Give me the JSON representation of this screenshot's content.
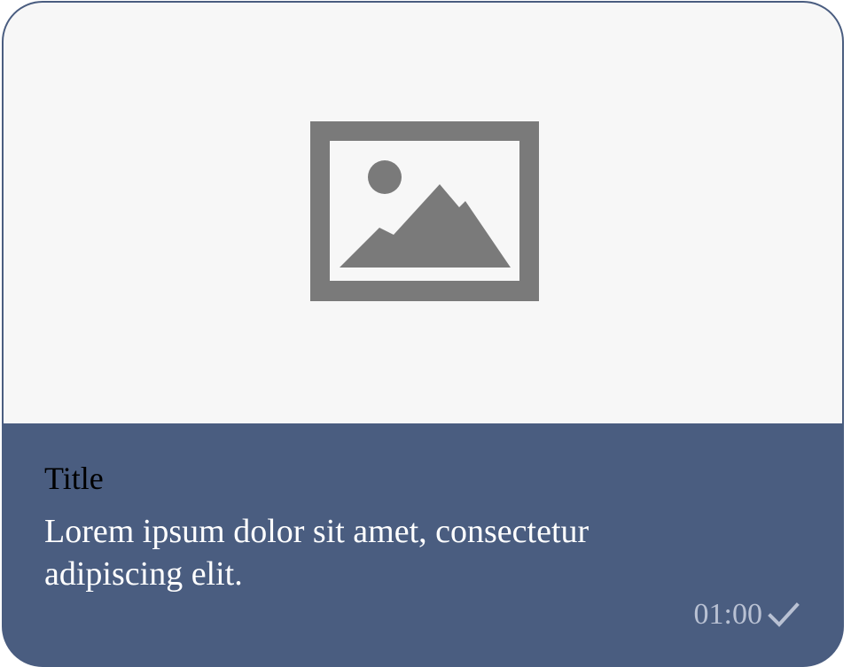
{
  "card": {
    "media": {
      "icon": "image-placeholder-icon"
    },
    "title": "Title",
    "description": "Lorem ipsum dolor sit amet, consectetur adipiscing elit.",
    "time": "01:00",
    "status_icon": "checkmark-icon"
  },
  "colors": {
    "card_body": "#4a5d80",
    "media_background": "#f7f7f7",
    "icon": "#7a7a7a",
    "title_text": "#000000",
    "description_text": "#ffffff",
    "meta_text": "#b9c1d3"
  }
}
